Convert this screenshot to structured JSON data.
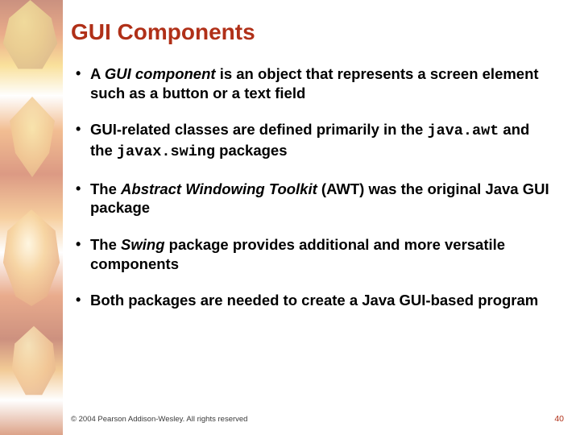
{
  "title": "GUI Components",
  "bullets": [
    {
      "pre": "A ",
      "em": "GUI component",
      "post": " is an object that represents a screen element such as a button or a text field"
    },
    {
      "pre": "GUI-related classes are defined primarily in the ",
      "code1": "java.awt",
      "mid": " and the ",
      "code2": "javax.swing",
      "post": " packages"
    },
    {
      "pre": "The ",
      "em": "Abstract Windowing Toolkit",
      "post": " (AWT) was the original Java GUI package"
    },
    {
      "pre": "The ",
      "em": "Swing",
      "post": " package provides additional and more versatile components"
    },
    {
      "pre": "Both packages are needed to create a Java GUI-based program"
    }
  ],
  "footer": "© 2004 Pearson Addison-Wesley. All rights reserved",
  "pagenum": "40"
}
